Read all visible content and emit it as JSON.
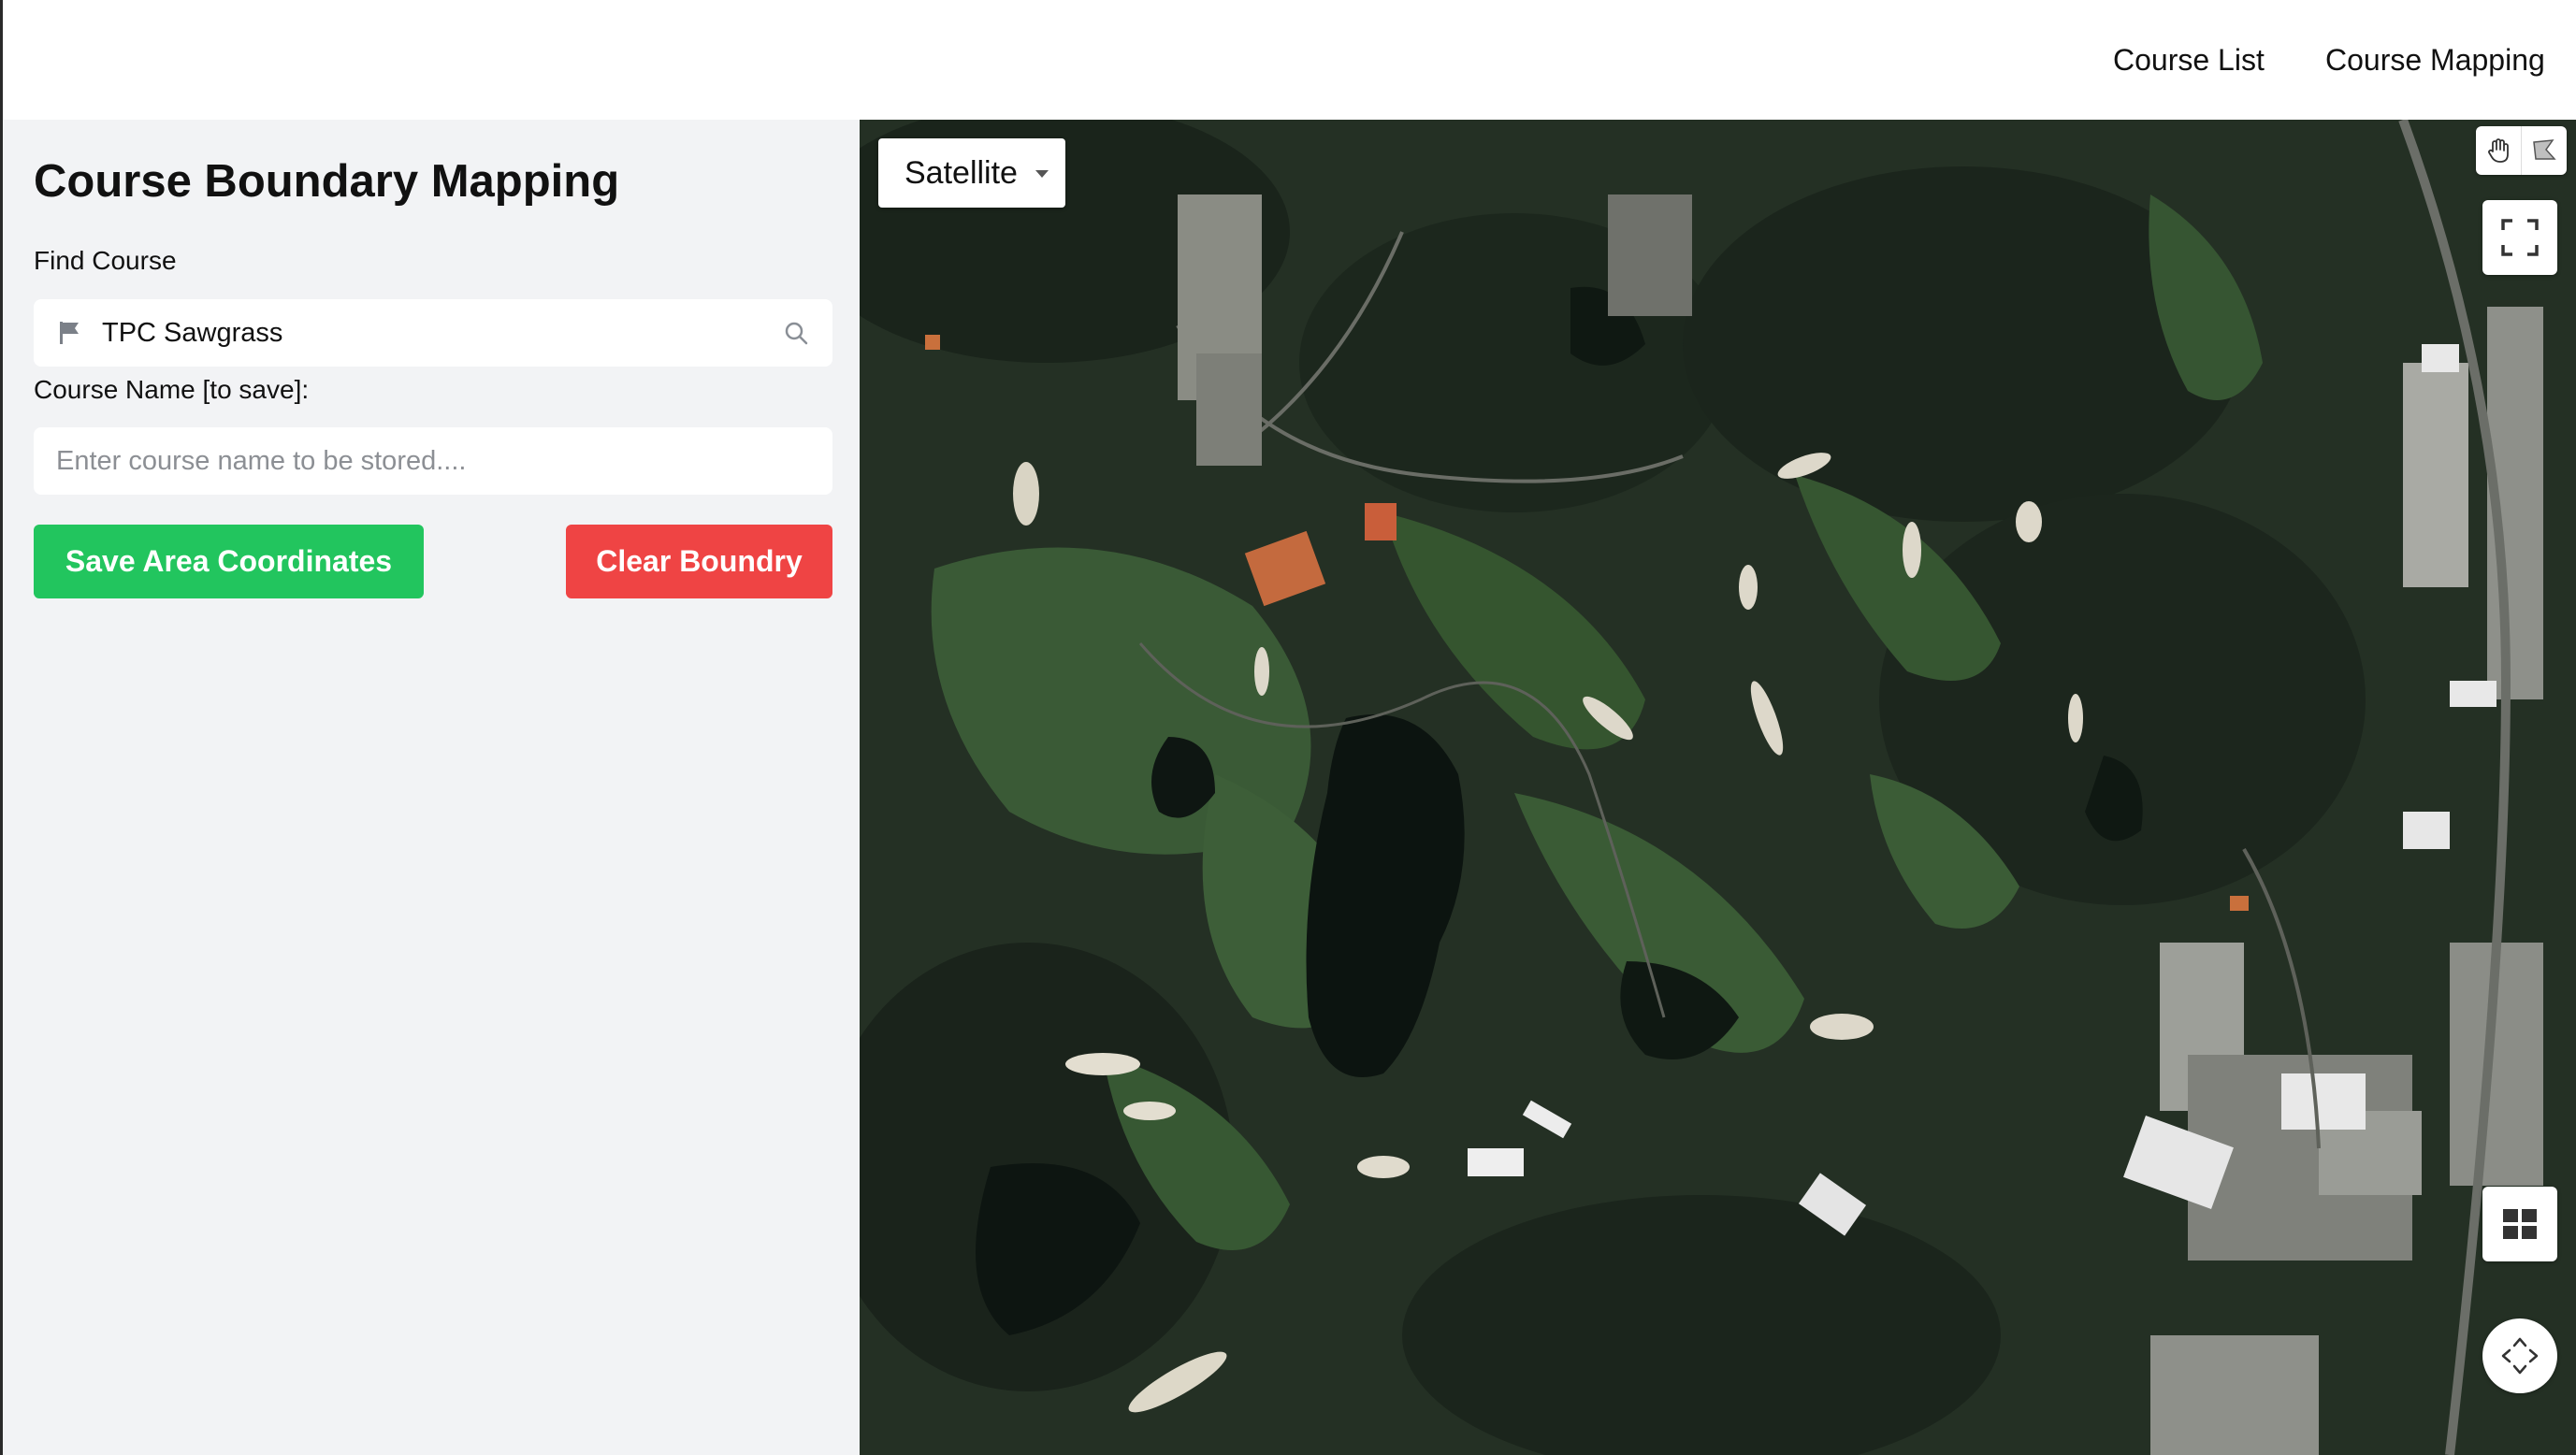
{
  "nav": {
    "course_list": "Course List",
    "course_mapping": "Course Mapping"
  },
  "sidebar": {
    "title": "Course Boundary Mapping",
    "find_label": "Find Course",
    "find_value": "TPC Sawgrass",
    "name_label": "Course Name [to save]:",
    "name_placeholder": "Enter course name to be stored....",
    "name_value": "",
    "save_button": "Save Area Coordinates",
    "clear_button": "Clear Boundry"
  },
  "map": {
    "layer": "Satellite",
    "icons": [
      "hand-pan-icon",
      "polygon-draw-icon",
      "fullscreen-icon",
      "grid-icon",
      "move-arrows-icon"
    ]
  },
  "colors": {
    "save": "#22c55e",
    "clear": "#ef4444",
    "sidebar_bg": "#f2f3f5"
  }
}
